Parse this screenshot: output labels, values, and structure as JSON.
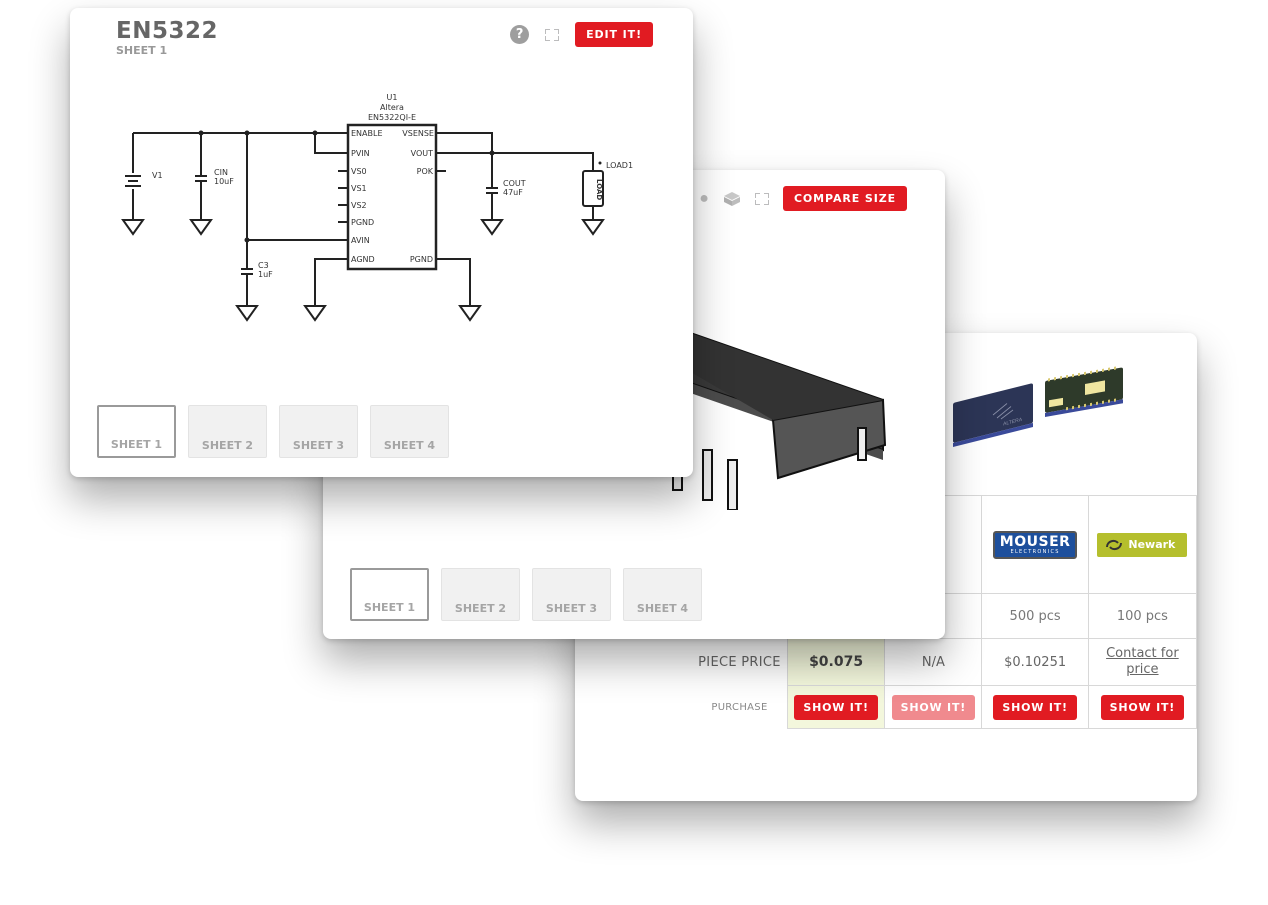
{
  "schematic_card": {
    "title": "EN5322",
    "subtitle": "SHEET 1",
    "edit_button": "EDIT IT!",
    "icons": [
      "help-icon",
      "fullscreen-icon"
    ],
    "component": {
      "ref": "U1",
      "manufacturer": "Altera",
      "part": "EN5322QI-E",
      "left_pins": [
        "ENABLE",
        "PVIN",
        "VS0",
        "VS1",
        "VS2",
        "PGND",
        "AVIN",
        "AGND"
      ],
      "right_pins": [
        "VSENSE",
        "VOUT",
        "POK",
        "PGND"
      ]
    },
    "parts": {
      "v1": "V1",
      "cin_name": "CIN",
      "cin_value": "10uF",
      "c3_name": "C3",
      "c3_value": "1uF",
      "cout_name": "COUT",
      "cout_value": "47uF",
      "load_name": "LOAD1",
      "load_body": "LOAD"
    },
    "sheets": [
      "SHEET 1",
      "SHEET 2",
      "SHEET 3",
      "SHEET 4"
    ],
    "active_sheet": 0
  },
  "model_card": {
    "compare_button": "COMPARE SIZE",
    "icons": [
      "help-icon",
      "cube-icon",
      "fullscreen-icon"
    ],
    "sheets": [
      "SHEET 1",
      "SHEET 2",
      "SHEET 3",
      "SHEET 4"
    ],
    "active_sheet": 0
  },
  "pricing_card": {
    "rows": {
      "piece_price_label": "PIECE PRICE",
      "purchase_label": "PURCHASE"
    },
    "suppliers": [
      {
        "name": "",
        "quantity": "",
        "price": "$0.075",
        "best": true,
        "button": "SHOW IT!",
        "enabled": true
      },
      {
        "name": "",
        "quantity": "",
        "price": "N/A",
        "best": false,
        "button": "SHOW IT!",
        "enabled": false
      },
      {
        "name": "Mouser Electronics",
        "logo_big": "MOUSER",
        "logo_small": "ELECTRONICS",
        "quantity": "500 pcs",
        "price": "$0.10251",
        "best": false,
        "button": "SHOW IT!",
        "enabled": true
      },
      {
        "name": "Newark",
        "logo_text": "Newark",
        "quantity": "100 pcs",
        "price": "Contact for price",
        "price_is_link": true,
        "best": false,
        "button": "SHOW IT!",
        "enabled": true
      }
    ]
  },
  "colors": {
    "accent_red": "#e11b22",
    "disabled_red": "#f08a8e",
    "best_price_bg": "#f3f7dc",
    "mouser_blue": "#1d4f9c",
    "newark_green": "#b5bf2d"
  }
}
